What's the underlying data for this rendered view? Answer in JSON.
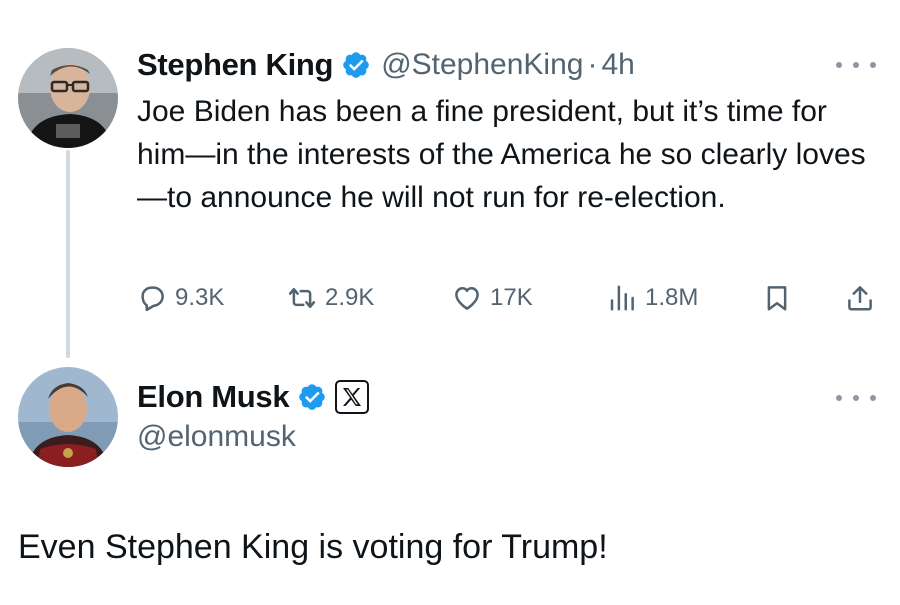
{
  "tweet": {
    "author_name": "Stephen King",
    "handle": "@StephenKing",
    "separator": "·",
    "time": "4h",
    "text": "Joe Biden has been a fine president, but it’s time for him—in the interests of the America he so clearly loves—to announce he will not run for re-election.",
    "stats": {
      "replies": "9.3K",
      "retweets": "2.9K",
      "likes": "17K",
      "views": "1.8M"
    },
    "verified": true
  },
  "reply": {
    "author_name": "Elon Musk",
    "handle": "@elonmusk",
    "verified": true,
    "affiliate_badge_icon": "x-logo-icon"
  },
  "caption": "Even Stephen King is voting for Trump!",
  "colors": {
    "verified_blue": "#1d9bf0",
    "secondary_text": "#536471",
    "thread_line": "#cfd9de"
  }
}
